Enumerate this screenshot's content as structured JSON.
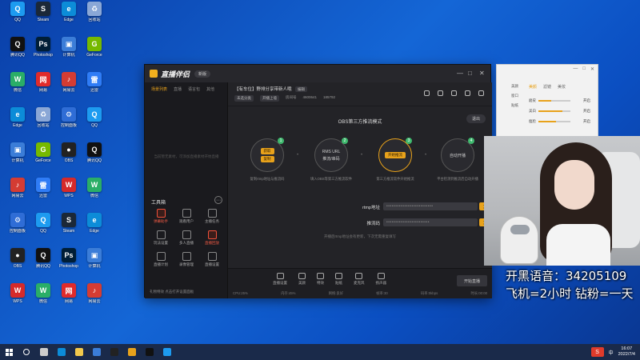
{
  "desktop": {
    "icons": [
      {
        "label": "QQ",
        "color": "#1d9bf0",
        "glyph": "Q"
      },
      {
        "label": "腾讯QQ",
        "color": "#111111",
        "glyph": "Q"
      },
      {
        "label": "微信",
        "color": "#2aae67",
        "glyph": "W"
      },
      {
        "label": "Edge",
        "color": "#0c8cd8",
        "glyph": "e"
      },
      {
        "label": "计算机",
        "color": "#3b7dd8",
        "glyph": "▣"
      },
      {
        "label": "网易云",
        "color": "#d43c33",
        "glyph": "♪"
      },
      {
        "label": "控制面板",
        "color": "#2f6dd6",
        "glyph": "⚙"
      },
      {
        "label": "OBS",
        "color": "#222222",
        "glyph": "●"
      },
      {
        "label": "WPS",
        "color": "#d52a2a",
        "glyph": "W"
      },
      {
        "label": "Steam",
        "color": "#1b2838",
        "glyph": "S"
      },
      {
        "label": "Photoshop",
        "color": "#001e36",
        "glyph": "Ps"
      },
      {
        "label": "网易",
        "color": "#e02b2b",
        "glyph": "网"
      },
      {
        "label": "回收站",
        "color": "#8aa7d6",
        "glyph": "♻"
      },
      {
        "label": "GeForce",
        "color": "#76b900",
        "glyph": "G"
      },
      {
        "label": "迅雷",
        "color": "#2f7cf6",
        "glyph": "雷"
      }
    ]
  },
  "app": {
    "name": "直播伴侣",
    "version_pill": "新版",
    "window_controls": [
      "—",
      "□",
      "✕"
    ],
    "sidebar": {
      "tabs": [
        "场景列表",
        "直播",
        "语言包",
        "其他"
      ],
      "empty_hint": "当前暂无素材，可添加直播素材开始直播",
      "toolbox_title": "工具箱",
      "tools": [
        {
          "label": "弹幕助手",
          "hot": true
        },
        {
          "label": "观看用户",
          "hot": false
        },
        {
          "label": "主播任务",
          "hot": false
        },
        {
          "label": "玩法设置",
          "hot": false
        },
        {
          "label": "多人直播",
          "hot": false
        },
        {
          "label": "直播回放",
          "hot": true
        },
        {
          "label": "直播计划",
          "hot": false
        },
        {
          "label": "录像管理",
          "hot": false
        },
        {
          "label": "直播设置",
          "hot": false
        }
      ],
      "footer": "礼物特效  点击打开设置面板"
    },
    "room": {
      "title": "【有车位】野排分享带新人哦",
      "title_tag": "编辑",
      "category": "未选分类",
      "mode": "开播上墙",
      "room_label": "房间号",
      "room_id": "4600641",
      "fans": "185792"
    },
    "obs": {
      "title": "OBS第三方推流模式",
      "exit_label": "退出",
      "steps": [
        {
          "num": "1",
          "lines": [
            "获取",
            "复制"
          ],
          "desc": "复制rtmp地址与推流码"
        },
        {
          "num": "2",
          "lines": [
            "RMS URL",
            "推流/串码"
          ],
          "desc": "填入OBS等第三方推流软件"
        },
        {
          "num": "3",
          "lines": [
            "开始推流"
          ],
          "desc": "第三方推流软件开始推流"
        },
        {
          "num": "4",
          "lines": [
            "自动开播"
          ],
          "desc": "平台检测到推流后自动开播"
        }
      ],
      "rtmp_label": "rtmp地址",
      "rtmp_value": "••••••••••••••••••••••••••",
      "key_label": "推流码",
      "key_value": "••••••••••••••••••••••••",
      "copy_label": "复制",
      "hint": "开播后rtmp地址会有更新，下次无需重复填写"
    },
    "bottom_tools": [
      "直播设置",
      "美颜",
      "特效",
      "贴纸",
      "麦克风",
      "扬声器"
    ],
    "start_label": "开始直播",
    "status": [
      "CPU:25%",
      "内存:45%",
      "网络:良好",
      "帧率:30",
      "码率:0kbps",
      "时长:00:00"
    ]
  },
  "beauty_panel": {
    "tabs": [
      "美颜",
      "滤镜",
      "美妆"
    ],
    "side_items": [
      "美颜",
      "窗口",
      "贴纸"
    ],
    "rows": [
      {
        "label": "磨皮",
        "level": 0.4
      },
      {
        "label": "美白",
        "level": 0.75
      },
      {
        "label": "瘦脸",
        "level": 0.55
      }
    ],
    "open_label": "开启"
  },
  "overlay": {
    "line1": "开黑语音：34205109",
    "line2": "飞机=2小时 钻粉=一天"
  },
  "taskbar": {
    "apps": [
      "search",
      "taskview",
      "edge",
      "explorer",
      "store",
      "obs",
      "chrome",
      "douyin",
      "qq"
    ],
    "ime_label": "中",
    "time": "16:07",
    "date": "2022/7/4"
  }
}
